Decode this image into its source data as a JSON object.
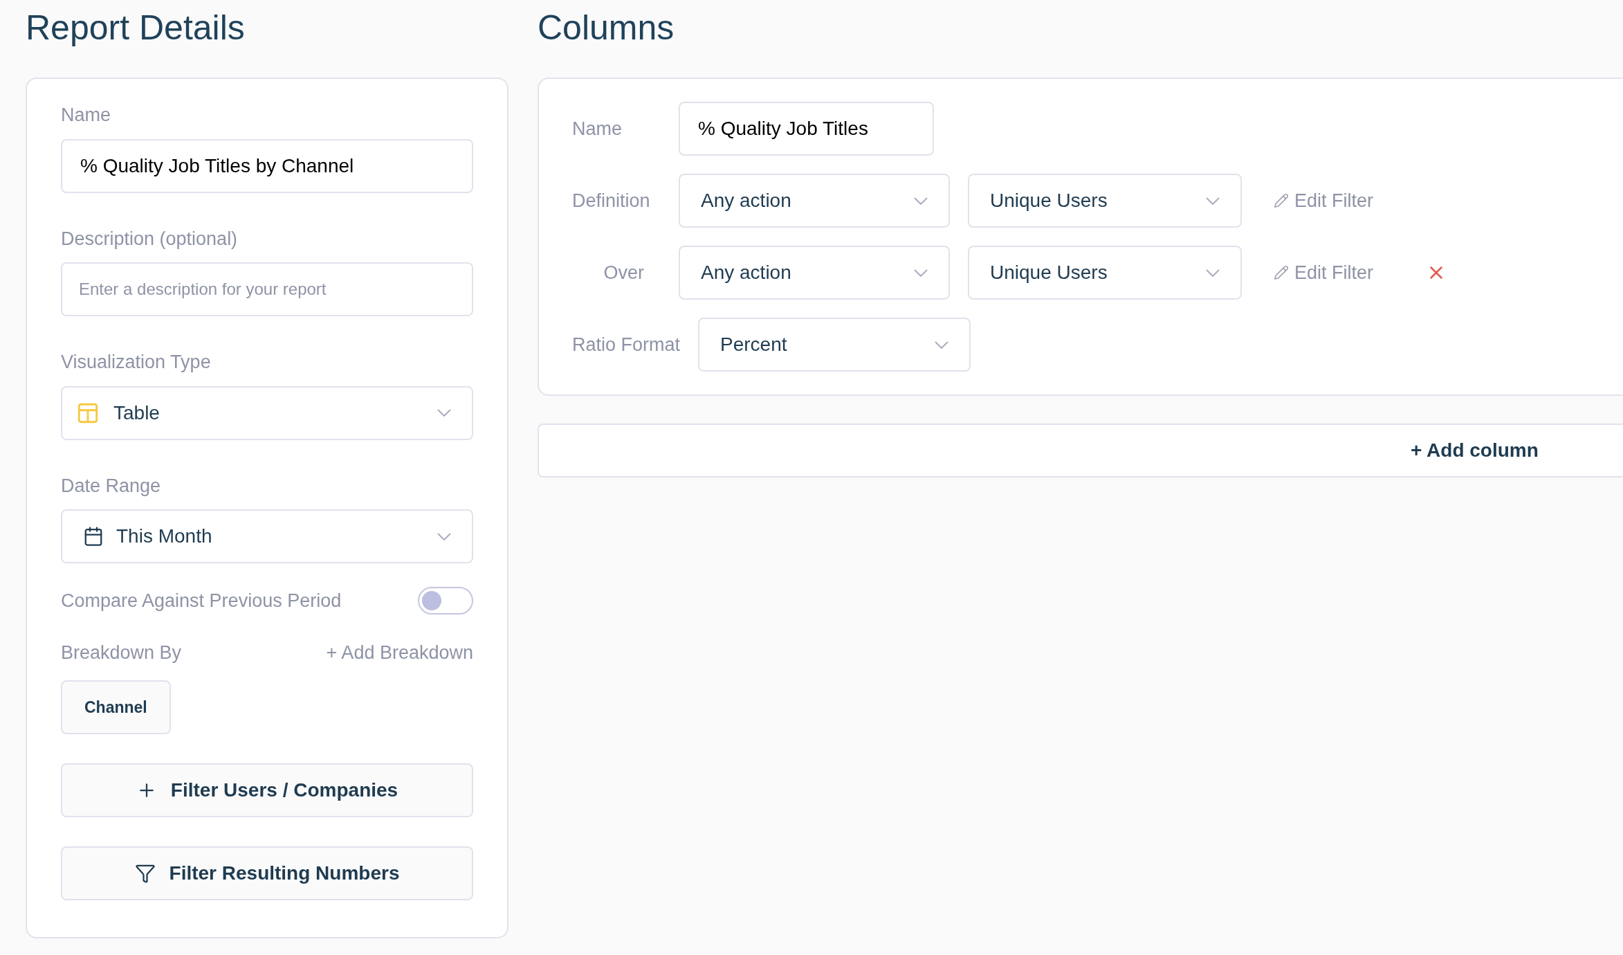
{
  "report_details": {
    "title": "Report Details",
    "name": {
      "label": "Name",
      "value": "% Quality Job Titles by Channel"
    },
    "description": {
      "label": "Description (optional)",
      "placeholder": "Enter a description for your report"
    },
    "visualization": {
      "label": "Visualization Type",
      "value": "Table"
    },
    "date_range": {
      "label": "Date Range",
      "value": "This Month"
    },
    "compare": {
      "label": "Compare Against Previous Period",
      "on": false
    },
    "breakdown": {
      "label": "Breakdown By",
      "add": "+ Add Breakdown",
      "chips": [
        "Channel"
      ]
    },
    "buttons": [
      {
        "kind": "plus",
        "label": "Filter Users / Companies"
      },
      {
        "kind": "funnel",
        "label": "Filter Resulting Numbers"
      }
    ]
  },
  "columns": {
    "title": "Columns",
    "rows": [
      {
        "kind": "text",
        "label": "Name",
        "value": "% Quality Job Titles"
      },
      {
        "kind": "metric",
        "label": "Definition",
        "event": "Any action",
        "measure": "Unique Users",
        "edit": "Edit Filter",
        "removable": false
      },
      {
        "kind": "metric",
        "label": "Over",
        "event": "Any action",
        "measure": "Unique Users",
        "edit": "Edit Filter",
        "removable": true
      },
      {
        "kind": "select",
        "label": "Ratio Format",
        "value": "Percent"
      }
    ],
    "add": "+ Add column"
  }
}
